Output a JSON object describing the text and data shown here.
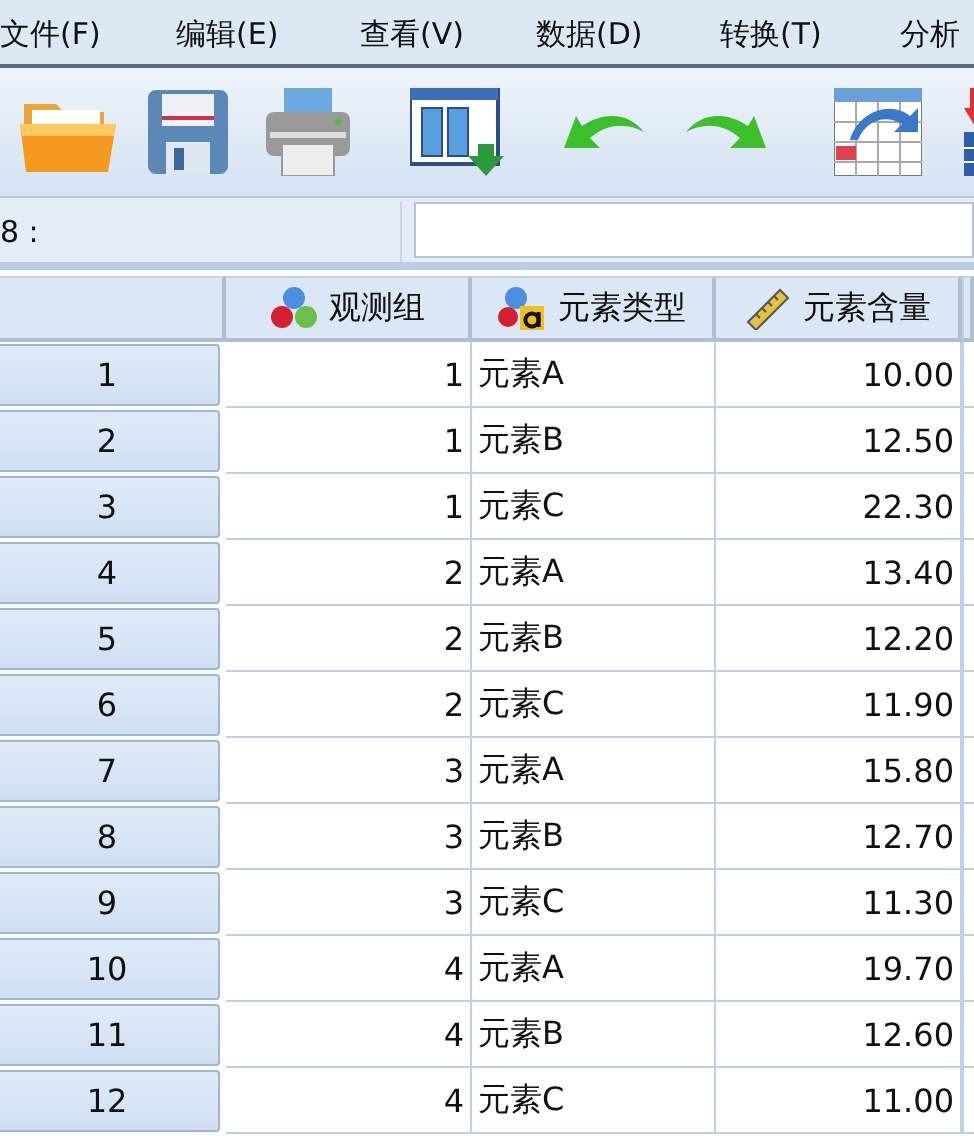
{
  "menu_bar": {
    "items": [
      "文件(F)",
      "编辑(E)",
      "查看(V)",
      "数据(D)",
      "转换(T)",
      "分析"
    ]
  },
  "toolbar": {
    "buttons": [
      {
        "kind": "open"
      },
      {
        "kind": "save"
      },
      {
        "kind": "print"
      },
      {
        "kind": "recall"
      },
      {
        "kind": "undo"
      },
      {
        "kind": "redo"
      },
      {
        "kind": "goto"
      },
      {
        "kind": "insert"
      }
    ]
  },
  "cell_bar": {
    "label": "8 :"
  },
  "table": {
    "columns": [
      {
        "name": "观测组",
        "kind": "nominal"
      },
      {
        "name": "元素类型",
        "kind": "string"
      },
      {
        "name": "元素含量",
        "kind": "scale"
      }
    ],
    "rows": [
      {
        "case": "1",
        "cells": [
          "1",
          "元素A",
          "10.00"
        ]
      },
      {
        "case": "2",
        "cells": [
          "1",
          "元素B",
          "12.50"
        ]
      },
      {
        "case": "3",
        "cells": [
          "1",
          "元素C",
          "22.30"
        ]
      },
      {
        "case": "4",
        "cells": [
          "2",
          "元素A",
          "13.40"
        ]
      },
      {
        "case": "5",
        "cells": [
          "2",
          "元素B",
          "12.20"
        ]
      },
      {
        "case": "6",
        "cells": [
          "2",
          "元素C",
          "11.90"
        ]
      },
      {
        "case": "7",
        "cells": [
          "3",
          "元素A",
          "15.80"
        ]
      },
      {
        "case": "8",
        "cells": [
          "3",
          "元素B",
          "12.70"
        ]
      },
      {
        "case": "9",
        "cells": [
          "3",
          "元素C",
          "11.30"
        ]
      },
      {
        "case": "10",
        "cells": [
          "4",
          "元素A",
          "19.70"
        ]
      },
      {
        "case": "11",
        "cells": [
          "4",
          "元素B",
          "12.60"
        ]
      },
      {
        "case": "12",
        "cells": [
          "4",
          "元素C",
          "11.00"
        ]
      }
    ]
  }
}
